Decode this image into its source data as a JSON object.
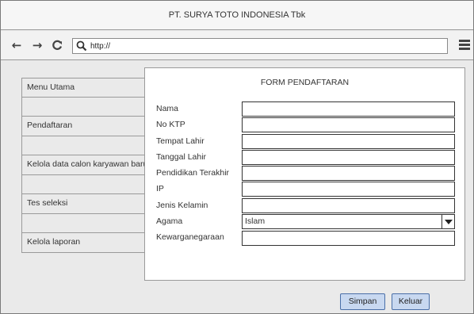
{
  "window": {
    "title": "PT. SURYA TOTO INDONESIA Tbk"
  },
  "toolbar": {
    "back_glyph": "←",
    "forward_glyph": "→",
    "reload_glyph": "C",
    "url": "http://",
    "icons": [
      "back-icon",
      "forward-icon",
      "reload-icon",
      "search-icon",
      "hamburger-menu-icon"
    ]
  },
  "sidebar": {
    "items": [
      {
        "label": "Menu Utama"
      },
      {
        "label": ""
      },
      {
        "label": "Pendaftaran"
      },
      {
        "label": ""
      },
      {
        "label": "Kelola data calon karyawan baru"
      },
      {
        "label": ""
      },
      {
        "label": "Tes seleksi"
      },
      {
        "label": ""
      },
      {
        "label": "Kelola laporan"
      }
    ]
  },
  "form": {
    "title": "FORM PENDAFTARAN",
    "fields": [
      {
        "label": "Nama",
        "value": ""
      },
      {
        "label": "No KTP",
        "value": ""
      },
      {
        "label": "Tempat Lahir",
        "value": ""
      },
      {
        "label": "Tanggal Lahir",
        "value": ""
      },
      {
        "label": "Pendidikan Terakhir",
        "value": ""
      },
      {
        "label": "IP",
        "value": ""
      },
      {
        "label": "Jenis Kelamin",
        "value": ""
      },
      {
        "label": "Agama",
        "value": "Islam",
        "type": "select"
      },
      {
        "label": "Kewarganegaraan",
        "value": ""
      }
    ]
  },
  "actions": {
    "save_label": "Simpan",
    "exit_label": "Keluar"
  },
  "colors": {
    "button_fill": "#c8d8f0",
    "button_border": "#4a6fa8",
    "window_bg": "#eaeaea"
  }
}
